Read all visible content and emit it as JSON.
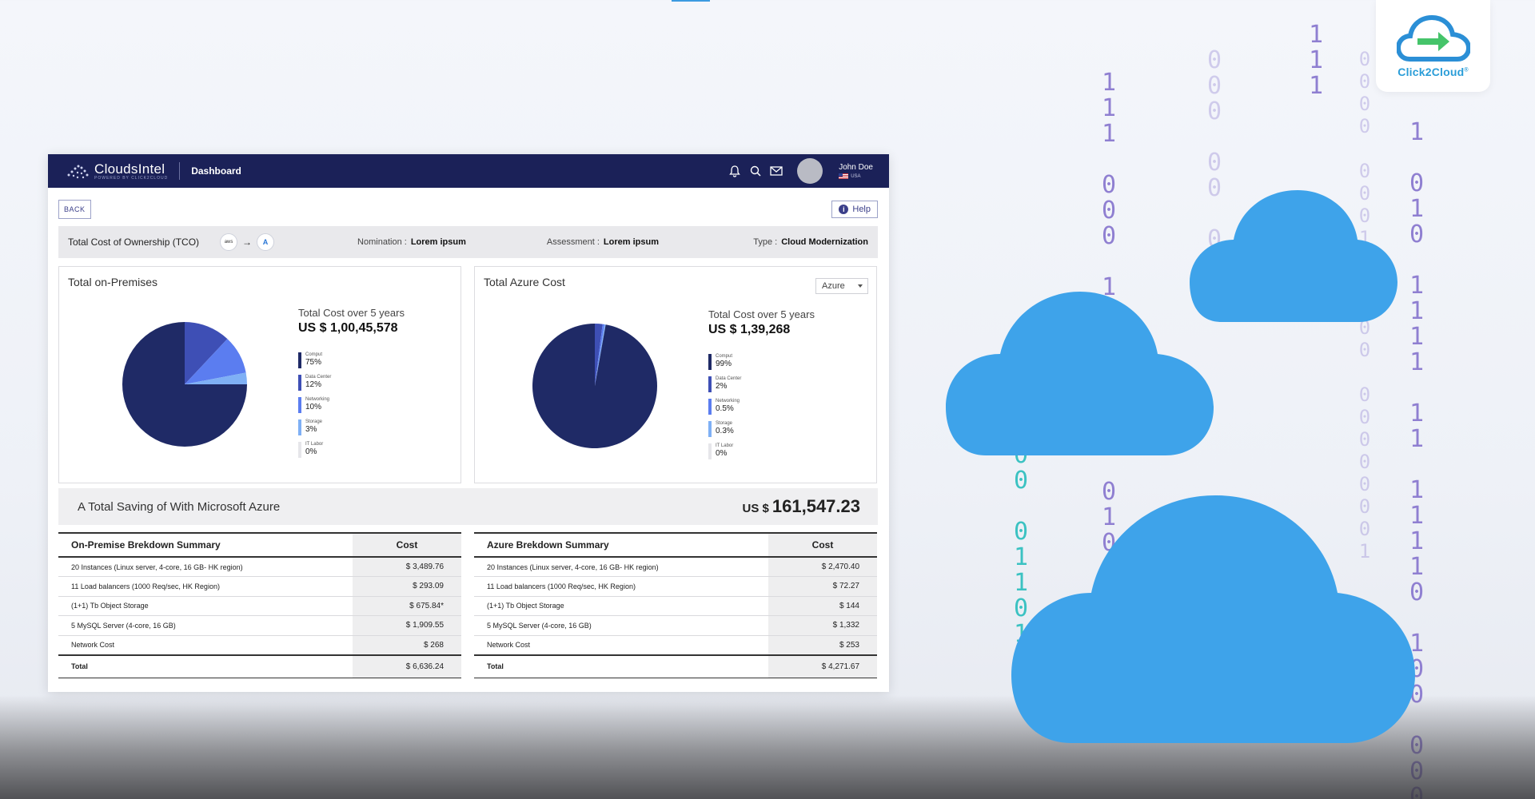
{
  "app": {
    "brand_name": "CloudsIntel",
    "brand_tagline": "POWERED BY CLICK2CLOUD",
    "nav_title": "Dashboard",
    "user_name": "John Doe",
    "user_country": "USA"
  },
  "toolbar": {
    "back_label": "BACK",
    "help_label": "Help",
    "help_glyph": "i"
  },
  "info_bar": {
    "title": "Total Cost of Ownership (TCO)",
    "source_badge": "aws",
    "target_badge": "A",
    "arrow": "→",
    "nomination_label": "Nomination :",
    "nomination_value": "Lorem ipsum",
    "assessment_label": "Assessment :",
    "assessment_value": "Lorem ipsum",
    "type_label": "Type :",
    "type_value": "Cloud Modernization"
  },
  "on_prem": {
    "title": "Total on-Premises",
    "total_label": "Total Cost over 5 years",
    "total_value": "US $ 1,00,45,578",
    "legend": [
      {
        "name": "Comput",
        "pct": "75%",
        "value": 75,
        "color": "#1f2a66"
      },
      {
        "name": "Data Center",
        "pct": "12%",
        "value": 12,
        "color": "#3e4fb5"
      },
      {
        "name": "Networking",
        "pct": "10%",
        "value": 10,
        "color": "#5b7df0"
      },
      {
        "name": "Storage",
        "pct": "3%",
        "value": 3,
        "color": "#7fb0f5"
      },
      {
        "name": "IT Labor",
        "pct": "0%",
        "value": 0,
        "color": "#e6e6ea"
      }
    ]
  },
  "azure": {
    "title": "Total Azure Cost",
    "dropdown_value": "Azure",
    "total_label": "Total Cost over 5 years",
    "total_value": "US $ 1,39,268",
    "legend": [
      {
        "name": "Comput",
        "pct": "99%",
        "value": 97.2,
        "color": "#1f2a66"
      },
      {
        "name": "Data Center",
        "pct": "2%",
        "value": 2,
        "color": "#3e4fb5"
      },
      {
        "name": "Networking",
        "pct": "0.5%",
        "value": 0.5,
        "color": "#5b7df0"
      },
      {
        "name": "Storage",
        "pct": "0.3%",
        "value": 0.3,
        "color": "#7fb0f5"
      },
      {
        "name": "IT Labor",
        "pct": "0%",
        "value": 0,
        "color": "#e6e6ea"
      }
    ]
  },
  "saving": {
    "label": "A Total Saving of With Microsoft Azure",
    "currency": "US $",
    "value": "161,547.23"
  },
  "on_prem_table": {
    "header_item": "On-Premise Brekdown Summary",
    "header_cost": "Cost",
    "rows": [
      {
        "item": "20 Instances (Linux server, 4-core, 16 GB- HK region)",
        "cost": "$ 3,489.76"
      },
      {
        "item": "11 Load balancers (1000 Req/sec, HK Region)",
        "cost": "$ 293.09"
      },
      {
        "item": "(1+1) Tb Object Storage",
        "cost": "$ 675.84*"
      },
      {
        "item": "5 MySQL Server (4-core, 16 GB)",
        "cost": "$ 1,909.55"
      },
      {
        "item": "Network Cost",
        "cost": "$ 268"
      }
    ],
    "total_label": "Total",
    "total_cost": "$ 6,636.24"
  },
  "azure_table": {
    "header_item": "Azure Brekdown Summary",
    "header_cost": "Cost",
    "rows": [
      {
        "item": "20 Instances (Linux server, 4-core, 16 GB- HK region)",
        "cost": "$ 2,470.40"
      },
      {
        "item": "11 Load balancers (1000 Req/sec, HK Region)",
        "cost": "$ 72.27"
      },
      {
        "item": "(1+1) Tb Object Storage",
        "cost": "$ 144"
      },
      {
        "item": "5 MySQL Server (4-core, 16 GB)",
        "cost": "$ 1,332"
      },
      {
        "item": "Network Cost",
        "cost": "$ 253"
      }
    ],
    "total_label": "Total",
    "total_cost": "$ 4,271.67"
  },
  "logo": {
    "name": "Click2Cloud",
    "mark": "®"
  },
  "binary": {
    "col1": "1\n1\n1",
    "col2": "0\n0\n0\n\n0\n0\n\n0",
    "col3": "1\n1\n1\n\n0\n0\n0\n\n1\n1\n1\n0\n\n0\n1\n\n0\n1\n0\n0\n0\n\n1\n1\n1",
    "col4": "0\n0\n0\n0\n\n0\n0\n0\n1\n\n0\n1\n0\n0\n\n0\n0\n0\n0\n0\n0\n0\n1",
    "col5": "1\n\n0\n1\n0\n\n1\n1\n1\n1\n\n1\n1\n\n1\n1\n1\n1\n0\n\n1\n0\n0\n\n0\n0\n0\n1",
    "col6": "0\n1\n0\n0\n\n0\n1\n1\n0\n1"
  },
  "colors": {
    "topbar": "#1b2158",
    "cloud": "#3ea3ea",
    "binary_purple": "#8f7fd1",
    "binary_teal": "#3bc2c2"
  }
}
